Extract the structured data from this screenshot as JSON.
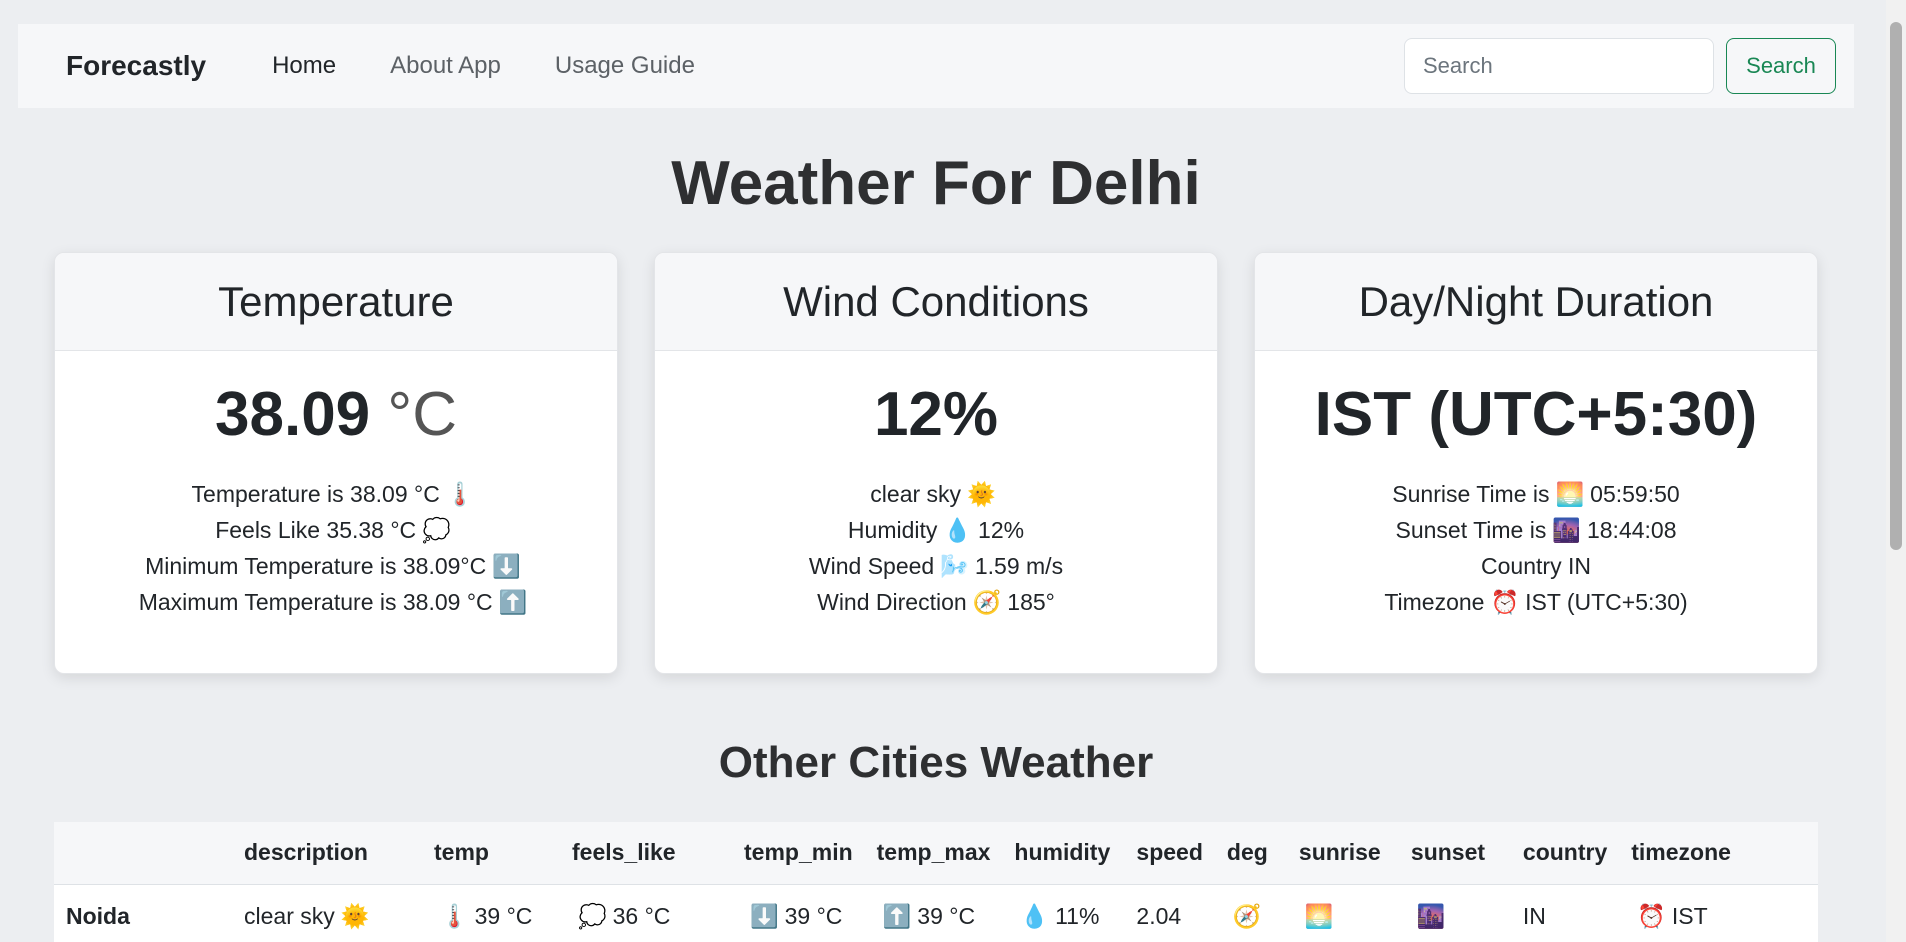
{
  "navbar": {
    "brand": "Forecastly",
    "links": [
      "Home",
      "About App",
      "Usage Guide"
    ],
    "search_placeholder": "Search",
    "search_button": "Search"
  },
  "main": {
    "title": "Weather For Delhi"
  },
  "cards": {
    "temperature": {
      "title": "Temperature",
      "value": "38.09",
      "unit": "°C",
      "lines": [
        {
          "text": "Temperature is 38.09 °C",
          "emoji": "🌡️",
          "after": ""
        },
        {
          "text": "Feels Like 35.38 °C",
          "emoji": "💭",
          "after": ""
        },
        {
          "text": "Minimum Temperature is 38.09°C",
          "emoji": "⬇️",
          "after": ""
        },
        {
          "text": "Maximum Temperature is 38.09 °C",
          "emoji": "⬆️",
          "after": ""
        }
      ]
    },
    "wind": {
      "title": "Wind Conditions",
      "value": "12%",
      "lines": [
        {
          "text": "clear sky",
          "emoji": "🌞",
          "after": ""
        },
        {
          "text": "Humidity",
          "emoji": "💧",
          "after": "12%"
        },
        {
          "text": "Wind Speed",
          "emoji": "🌬️",
          "after": "1.59 m/s"
        },
        {
          "text": "Wind Direction",
          "emoji": "🧭",
          "after": "185°"
        }
      ]
    },
    "daynight": {
      "title": "Day/Night Duration",
      "value": "IST (UTC+5:30)",
      "lines": [
        {
          "text": "Sunrise Time is",
          "emoji": "🌅",
          "after": "05:59:50"
        },
        {
          "text": "Sunset Time is",
          "emoji": "🌆",
          "after": "18:44:08"
        },
        {
          "text": "Country IN",
          "emoji": "",
          "after": ""
        },
        {
          "text": "Timezone",
          "emoji": "⏰",
          "after": "IST (UTC+5:30)"
        }
      ]
    }
  },
  "other_cities": {
    "title": "Other Cities Weather",
    "columns": [
      "",
      "description",
      "temp",
      "feels_like",
      "temp_min",
      "temp_max",
      "humidity",
      "speed",
      "deg",
      "sunrise",
      "sunset",
      "country",
      "timezone"
    ],
    "rows": [
      {
        "city": "Noida",
        "description": "clear sky",
        "description_icon": "🌞",
        "temp": "39 °C",
        "temp_icon": "🌡️",
        "feels_like": "36 °C",
        "feels_like_icon": "💭",
        "temp_min": "39 °C",
        "temp_min_icon": "⬇️",
        "temp_max": "39 °C",
        "temp_max_icon": "⬆️",
        "humidity": "11%",
        "humidity_icon": "💧",
        "speed": "2.04",
        "deg_icon": "🧭",
        "sunrise_icon": "🌅",
        "sunset_icon": "🌆",
        "country": "IN",
        "timezone": "IST",
        "timezone_icon": "⏰"
      }
    ]
  }
}
